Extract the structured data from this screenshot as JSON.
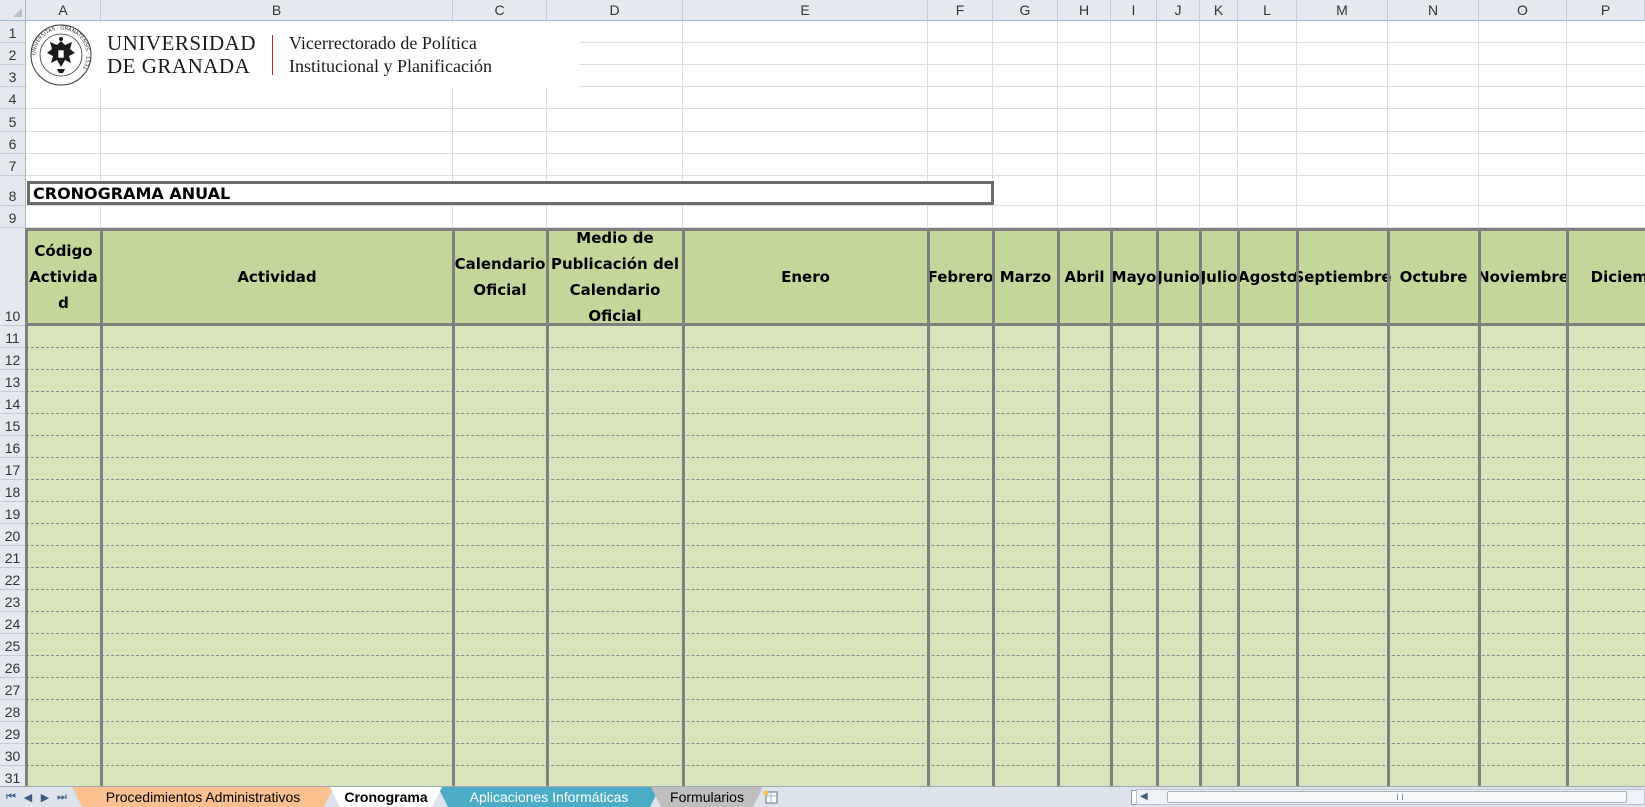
{
  "columns": [
    "A",
    "B",
    "C",
    "D",
    "E",
    "F",
    "G",
    "H",
    "I",
    "J",
    "K",
    "L",
    "M",
    "N",
    "O",
    "P"
  ],
  "rows": [
    "1",
    "2",
    "3",
    "4",
    "5",
    "6",
    "7",
    "8",
    "9",
    "10",
    "11",
    "12",
    "13",
    "14",
    "15",
    "16",
    "17",
    "18",
    "19",
    "20",
    "21",
    "22",
    "23",
    "24",
    "25",
    "26",
    "27",
    "28",
    "29",
    "30",
    "31"
  ],
  "logo": {
    "university_line1": "UNIVERSIDAD",
    "university_line2": "DE GRANADA",
    "vice_line1": "Vicerrectorado de Política",
    "vice_line2": "Institucional y Planificación",
    "seal_text": "UNIVERSITAS · GRANATENSIS · 1531",
    "accent_color": "#c1272d"
  },
  "title": "CRONOGRAMA ANUAL",
  "table": {
    "headers": [
      {
        "lines": [
          "Código",
          "Activida",
          "d"
        ]
      },
      {
        "lines": [
          "Actividad"
        ]
      },
      {
        "lines": [
          "Calendario",
          "Oficial"
        ]
      },
      {
        "lines": [
          "Medio de",
          "Publicación del",
          "Calendario",
          "Oficial"
        ]
      },
      {
        "lines": [
          "Enero"
        ]
      },
      {
        "lines": [
          "Febrero"
        ]
      },
      {
        "lines": [
          "Marzo"
        ]
      },
      {
        "lines": [
          "Abril"
        ]
      },
      {
        "lines": [
          "Mayo"
        ]
      },
      {
        "lines": [
          "Junio"
        ]
      },
      {
        "lines": [
          "Julio"
        ]
      },
      {
        "lines": [
          "Agosto"
        ]
      },
      {
        "lines": [
          "Septiembre"
        ]
      },
      {
        "lines": [
          "Octubre"
        ]
      },
      {
        "lines": [
          "Noviembre"
        ]
      },
      {
        "lines": [
          "Diciembre"
        ]
      }
    ],
    "header_fill": "#c4d79b",
    "body_fill": "#d8e4bc"
  },
  "tabs": [
    {
      "label": "Procedimientos Administrativos",
      "color": "#fac090",
      "text_color": "#000000",
      "active": false
    },
    {
      "label": "Cronograma",
      "color": "#ffffff",
      "text_color": "#000000",
      "active": true
    },
    {
      "label": "Aplicaciones Informáticas",
      "color": "#4bacc6",
      "text_color": "#ffffff",
      "active": false
    },
    {
      "label": "Formularios",
      "color": "#bfbfbf",
      "text_color": "#000000",
      "active": false
    }
  ],
  "nav_buttons": [
    "first-sheet-icon",
    "prev-sheet-icon",
    "next-sheet-icon",
    "last-sheet-icon"
  ],
  "new_sheet_icon": "insert-sheet-icon"
}
